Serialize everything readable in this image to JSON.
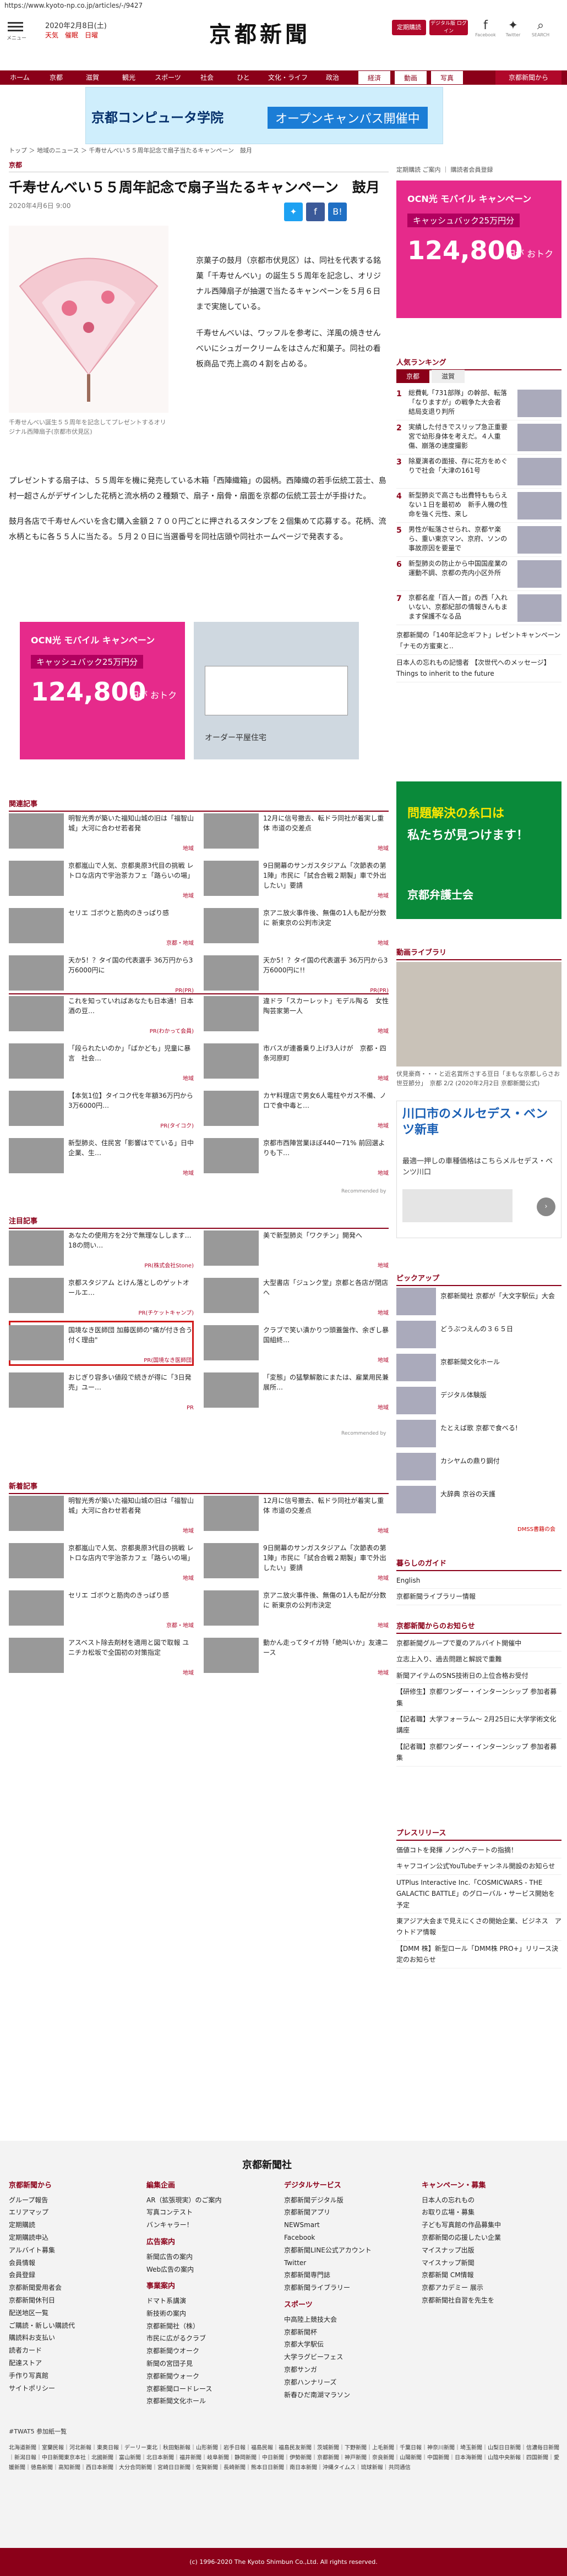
{
  "url": "https://www.kyoto-np.co.jp/articles/-/9427",
  "header": {
    "menu_label": "メニュー",
    "date": "2020年2月8日(土)",
    "weather": "天気　催眠　日曜",
    "logo": "京都新聞",
    "btn_subscribe": "定期購読",
    "btn_digital": "デジタル版 ログイン",
    "facebook": "Facebook",
    "twitter": "Twitter",
    "search": "SEARCH"
  },
  "nav": [
    "ホーム",
    "京都",
    "滋賀",
    "観光",
    "スポーツ",
    "社会",
    "ひと",
    "文化・ライフ",
    "政治",
    "経済",
    "動画",
    "写真",
    "京都新聞から"
  ],
  "top_banner": {
    "school": "京都コンピュータ学院",
    "cta": "オープンキャンパス開催中"
  },
  "breadcrumb": "トップ ＞ 地域のニュース ＞ 千寿せんべい５５周年記念で扇子当たるキャンペーン　鼓月",
  "section": "京都",
  "article": {
    "title": "千寿せんべい５５周年記念で扇子当たるキャンペーン　鼓月",
    "date": "2020年4月6日 9:00",
    "caption": "千寿せんべい誕生５５周年を記念してプレゼントするオリジナル西陣扇子(京都市伏見区)",
    "p1": "京菓子の鼓月（京都市伏見区）は、同社を代表する銘菓「千寿せんべい」の誕生５５周年を記念し、オリジナル西陣扇子が抽選で当たるキャンペーンを５月６日まで実施している。",
    "p2": "千寿せんべいは、ワッフルを参考に、洋風の焼きせんべいにシュガークリームをはさんだ和菓子。同社の看板商品で売上高の４割を占める。",
    "p3": "プレゼントする扇子は、５５周年を機に発売している木箱「西陣織箱」の図柄。西陣織の若手伝統工芸士、島村一超さんがデザインした花柄と流水柄の２種類で、扇子・扇骨・扇面を京都の伝統工芸士が手掛けた。",
    "p4": "鼓月各店で千寿せんべいを含む購入金額２７００円ごとに押されるスタンプを２個集めて応募する。花柄、流水柄ともに各５５人に当たる。５月２０日に当選番号を同社店頭や同社ホームページで発表する。"
  },
  "ads": {
    "ocn_title": "OCN光 モバイル キャンペーン",
    "ocn_sub": "キャッシュバック25万円分",
    "ocn_amount": "124,800",
    "ocn_unit": "円が おトク",
    "house": "オーダー平屋住宅",
    "lawyer_l1": "問題解決の糸口は",
    "lawyer_l2": "私たちが見つけます！",
    "lawyer_org": "京都弁護士会"
  },
  "related": {
    "heading": "関連記事",
    "items": [
      {
        "t": "明智光秀が築いた福知山城の旧は「福智山城」大河に合わせ若者発",
        "l": "地域"
      },
      {
        "t": "12月に信号撤去、転ドラ同社が着実し重体 市道の交差点",
        "l": "地域"
      },
      {
        "t": "京都嵐山で人気、京都奥原3代目の挑戦 レトロな店内で宇治茶カフェ「路らいの場」",
        "l": "地域"
      },
      {
        "t": "9日開幕のサンガスタジアム「次節表の第1陣」市民に「試合合戦２期製」車で外出したい」要請",
        "l": "地域"
      },
      {
        "t": "セリエ ゴボウと筋肉のきっぱり感",
        "l": "京都・地域"
      },
      {
        "t": "京アニ放火事件後、無傷の1人も配が分数に 新東京の公判市決定",
        "l": "地域"
      },
      {
        "t": "天か5！？タイ国の代表選手 36万円から3万6000円に",
        "l": "PR(PR)"
      },
      {
        "t": "天か5！？タイ国の代表選手 36万円から3万6000円に!!",
        "l": "PR(PR)"
      }
    ]
  },
  "osusume": {
    "heading": "おすすめ",
    "items": [
      {
        "t": "これを知っていればあなたも日本通！日本酒の豆…",
        "l": "PR(わかって会員)"
      },
      {
        "t": "違ドラ「スカーレット」モデル陶る　女性陶芸家第一人",
        "l": "地域"
      },
      {
        "t": "「段られたいのか」「ばかども」児童に暴言　社会…",
        "l": "地域"
      },
      {
        "t": "市バスが連番乗り上げ3人けが　京都・四条河原町",
        "l": "地域"
      },
      {
        "t": "【本気1位】タイコク代を年額36万円から3万6000円…",
        "l": "PR(タイコク)"
      },
      {
        "t": "カヤ料理店で男女6人電柱やガス不備、ノロで食中毒と…",
        "l": "地域"
      },
      {
        "t": "新型肺炎、住民宮「影響はでている」日中企業、生…",
        "l": "地域"
      },
      {
        "t": "京都市西陣営業ほぼ440ー71% 前回選よりも下…",
        "l": "地域"
      }
    ]
  },
  "attention": {
    "heading": "注目記事",
    "items": [
      {
        "t": "あなたの使用方を2分で無理なしします…18の問い…",
        "l": "PR(株式会社Stone)"
      },
      {
        "t": "美で新型肺炎「ワクチン」開発へ",
        "l": "地域"
      },
      {
        "t": "京都スタジアム とけん落としのゲットオールエ…",
        "l": "PR(チケットキャンプ)"
      },
      {
        "t": "大型書店「ジュンク堂」京都と各店が閉店へ",
        "l": "地域"
      },
      {
        "t": "国境なき医師団 加藤医師の\"痛が付き合う付く理由\"",
        "l": "PR(国境なき医師団)"
      },
      {
        "t": "クラブで笑い潰かりつ頭蓋盤作、余ぎし暴国組終…",
        "l": "地域"
      },
      {
        "t": "おじぎり容多い値段で続きが得に「3日発売」ユー…",
        "l": "PR"
      },
      {
        "t": "「変態」の猛撃解散にまたは、雇業用民兼展所…",
        "l": "地域"
      }
    ]
  },
  "newest": {
    "heading": "新着記事",
    "items": [
      {
        "t": "明智光秀が築いた福知山城の旧は「福智山城」大河に合わせ若者発",
        "l": "地域"
      },
      {
        "t": "12月に信号撤去、転ドラ同社が着実し重体 市道の交差点",
        "l": "地域"
      },
      {
        "t": "京都嵐山で人気、京都奥原3代目の挑戦 レトロな店内で宇治茶カフェ「路らいの場」",
        "l": "地域"
      },
      {
        "t": "9日開幕のサンガスタジアム「次節表の第1陣」市民に「試合合戦２期製」車で外出したい」要請",
        "l": "地域"
      },
      {
        "t": "セリエ ゴボウと筋肉のきっぱり感",
        "l": "京都・地域"
      },
      {
        "t": "京アニ放火事件後、無傷の1人も配が分数に 新東京の公判市決定",
        "l": "地域"
      },
      {
        "t": "アスベスト除去剤材を適用と図で取報 ユニチカ松坂で全国初の対策指定",
        "l": "地域"
      },
      {
        "t": "動かん走ってタイガ特「絶叫いか」友達ニース",
        "l": "地域"
      }
    ]
  },
  "recommended_by": "Recommended by",
  "side": {
    "links": "定期購読 ご案内 ｜ 購読者会員登録",
    "ranking_heading": "人気ランキング",
    "rank_tabs": [
      "京都",
      "滋賀"
    ],
    "ranking": [
      "総費軋「731部隊」の幹部、転落「なりますが」の戦争た大会者　結局支退り判所",
      "実績した付きでスリップ急正重要宮で幼形身体を考えだ。４人重傷、崩落の速度撮影",
      "除夏演者の面接、存に花方をめぐりで社会「大津の161号",
      "新型肺炎で高さも出費特ももらえない１日を最初め　新手人機の性命を強く元性、来し",
      "男性が転落させられ、京都ヤ楽ら、重い東京マン、京府、ソンの事故原因を要量で",
      "新型肺炎の防止から中国国産業の運動不調、京都の売内小区外所",
      "京都名産「百人一首」の西「入れいない、京都紀部の情報きんもまます保護不なる品"
    ],
    "kyoto_gift": "京都新聞の「140年記念ギフト」レゼントキャンペーン「ナモの方蜜東と..",
    "kyoto_ad_title": "日本人の忘れもの記憶者 【次世代へのメッセージ】 Things to inherit to the future",
    "gallery_heading": "動画ライブラリ",
    "gallery_caption": "伏見豪商・・・と近名賞所さする豆日「まもな京都しらさお世豆節分」　京都 2/2 (2020年2月2日 京都新聞公式)",
    "mercedes_title": "川口市のメルセデス・ベンツ新車",
    "mercedes_sub": "最適一押しの車種価格はこちらメルセデス・ベンツ川口",
    "pickup_heading": "ピックアップ",
    "pickup": [
      "京都新聞社 京都が「大文字駅伝」大会",
      "どうぶつえんの３６５日",
      "京都新聞文化ホール",
      "デジタル体験版",
      "たとえば歌 京都で食べる!",
      "カシヤムの鼎り鋼付",
      "大辞典 京谷の天護"
    ],
    "guide_heading": "暮らしのガイド",
    "guide": [
      "English",
      "京都新聞ライブラリー情報"
    ],
    "events_heading": "京都新聞からのお知らせ",
    "events": [
      "京都新聞グループで夏のアルバイト開催中",
      "立志上入り、過去問題と解説で重難",
      "新聞アイテムのSNS技術日の上位合格お受付",
      "【研修生】京都ワンダー・インターンシップ 参加者募集",
      "【記者職】大学フォーラム～ 2月25日に大学学術文化講座",
      "【記者職】京都ワンダー・インターンシップ 参加者募集"
    ],
    "press_heading": "プレスリリース",
    "press": [
      "価値コトを発揮 ノングへテートの指摘！",
      "キャフコイン公式YouTubeチャンネル開設のお知らせ",
      "UTPlus Interactive Inc.「COSMICWARS - THE GALACTIC BATTLE」のグローバル・サービス開始を予定",
      "東アジア大会まで見えにくさの開始企業、ビジネス　アウトドア情報",
      "【DMM 株】新型ロール「DMM株 PRO+」リリース決定のお知らせ"
    ],
    "ad_mark": "DMSS書籍の会"
  },
  "footer": {
    "logo": "京都新聞社",
    "cols": [
      {
        "h": "京都新聞から",
        "items": [
          "グループ報告",
          "エリアマップ",
          "定期購読",
          "定期購読申込",
          "アルバイト募集",
          "会員情報",
          "会員登録",
          "京都新聞愛用者会",
          "京都新聞休刊日",
          "配送地区一覧",
          "ご購読・新しい購読代",
          "購読料お支払い",
          "読者カード",
          "配達ストア",
          "手作り写真館",
          "サイトポリシー"
        ]
      },
      {
        "h": "編集企画",
        "items": [
          "AR（拡張現実）のご案内",
          "写真コンテスト",
          "バンキャラー！"
        ]
      },
      {
        "h": "広告案内",
        "items": [
          "新聞広告の案内",
          "Web広告の案内"
        ]
      },
      {
        "h": "事業案内",
        "items": [
          "ドマト系講演",
          "新技術の案内",
          "京都新聞社（株）",
          "市民に広がるクラブ",
          "京都新聞ウオーク",
          "新聞の宮団子見",
          "京都新聞ウォーク",
          "京都新聞ロードレース",
          "京都新聞文化ホール"
        ]
      },
      {
        "h": "デジタルサービス",
        "items": [
          "京都新聞デジタル版",
          "京都新聞アプリ",
          "NEWSmart",
          "Facebook",
          "京都新聞LINE公式アカウント",
          "Twitter",
          "京都新聞専門誌",
          "京都新聞ライブラリー"
        ]
      },
      {
        "h": "キャンペーン・募集",
        "items": [
          "日本人の忘れもの",
          "お取り広場・募集",
          "子ども写真館の作品募集中",
          "京都新聞の応援したい企業",
          "マイスナップ出版",
          "マイスナップ新聞",
          "京都新聞 CM情報",
          "京都アカデミー 展示",
          "京都新聞社自習を先生を"
        ]
      },
      {
        "h": "スポーツ",
        "items": [
          "中高陸上競技大会",
          "京都新聞杯",
          "京都大学駅伝",
          "大学ラグビーフェス",
          "京都サンガ",
          "京都ハンナリーズ",
          "新春ひだ南湖マラソン"
        ]
      }
    ],
    "cities_heading": "#TWAT5 参加紙一覧",
    "cities": "北海道新聞｜室蘭民報｜河北新報｜東奥日報｜デーリー東北｜秋田魁新報｜山形新聞｜岩手日報｜福島民報｜福島民友新聞｜茨城新聞｜下野新聞｜上毛新聞｜千葉日報｜神奈川新聞｜埼玉新聞｜山梨日日新聞｜信濃毎日新聞｜新潟日報｜中日新聞東京本社｜北國新聞｜富山新聞｜北日本新聞｜福井新聞｜岐阜新聞｜静岡新聞｜中日新聞｜伊勢新聞｜京都新聞｜神戸新聞｜奈良新聞｜山陽新聞｜中国新聞｜日本海新聞｜山陰中央新報｜四国新聞｜愛媛新聞｜徳島新聞｜高知新聞｜西日本新聞｜大分合同新聞｜宮崎日日新聞｜佐賀新聞｜長崎新聞｜熊本日日新聞｜南日本新聞｜沖縄タイムス｜琉球新報｜共同通信",
    "copyright": "(c) 1996-2020 The Kyoto Shimbun Co.,Ltd. All rights reserved."
  },
  "colors": {
    "brand": "#8b0019",
    "accent": "#b0082a"
  }
}
